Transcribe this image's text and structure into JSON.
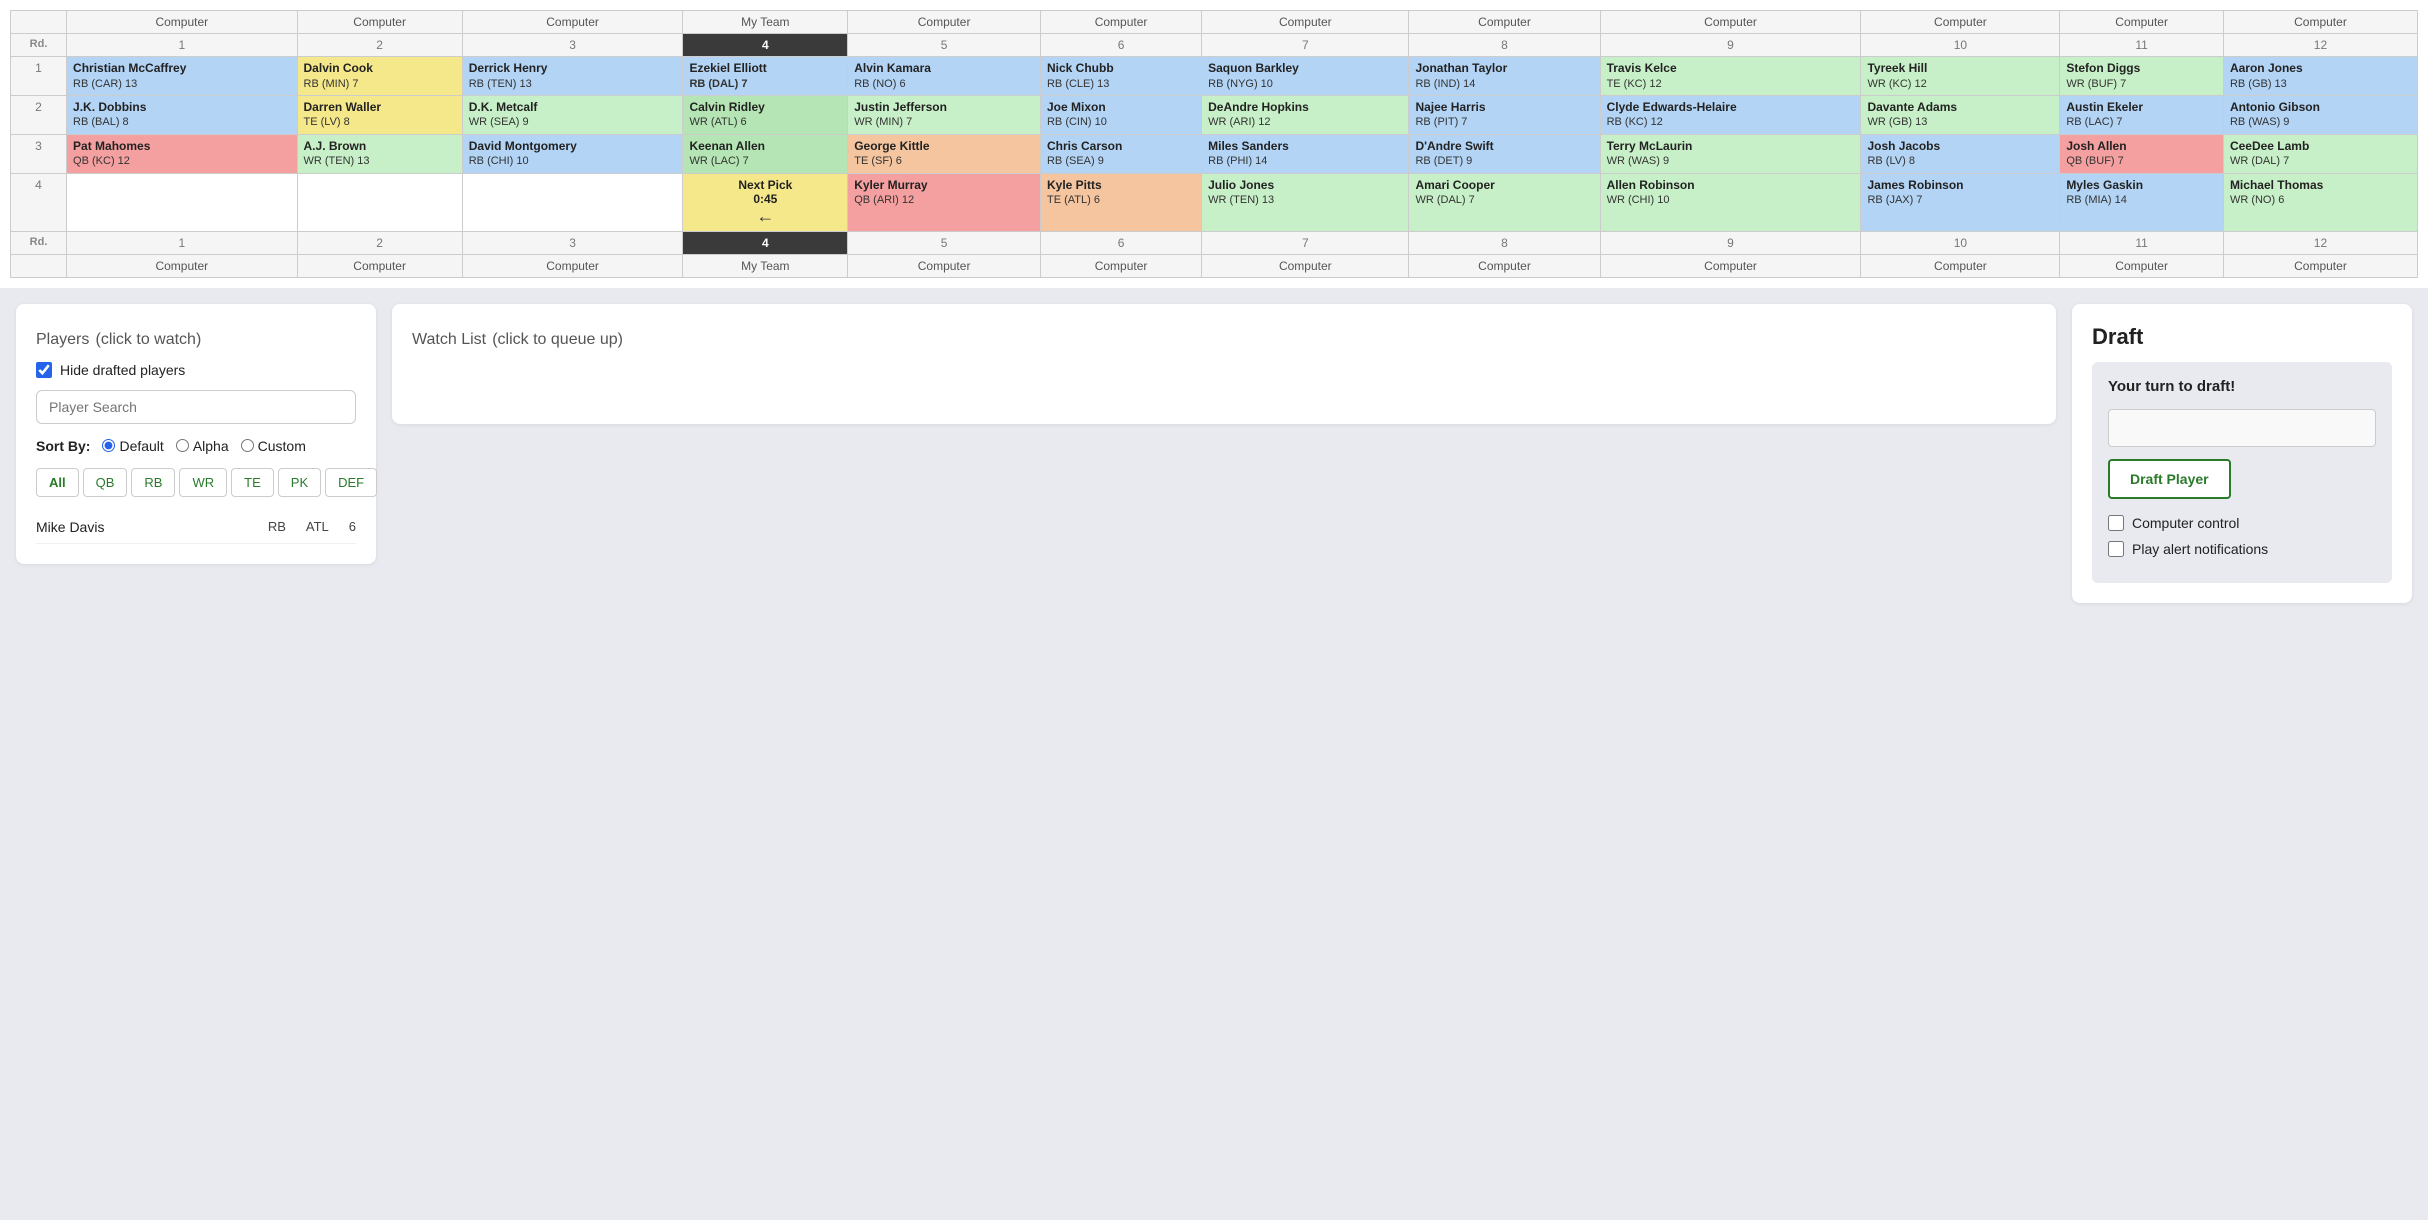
{
  "teams": [
    {
      "label": "Computer",
      "col": 1
    },
    {
      "label": "Computer",
      "col": 2
    },
    {
      "label": "Computer",
      "col": 3
    },
    {
      "label": "My Team",
      "col": 4
    },
    {
      "label": "Computer",
      "col": 5
    },
    {
      "label": "Computer",
      "col": 6
    },
    {
      "label": "Computer",
      "col": 7
    },
    {
      "label": "Computer",
      "col": 8
    },
    {
      "label": "Computer",
      "col": 9
    },
    {
      "label": "Computer",
      "col": 10
    },
    {
      "label": "Computer",
      "col": 11
    },
    {
      "label": "Computer",
      "col": 12
    }
  ],
  "rounds": [
    {
      "round": 1,
      "picks": [
        {
          "name": "Christian McCaffrey",
          "pos": "RB (CAR) 13",
          "color": "cell-blue"
        },
        {
          "name": "Dalvin Cook",
          "pos": "RB (MIN) 7",
          "color": "cell-yellow"
        },
        {
          "name": "Derrick Henry",
          "pos": "RB (TEN) 13",
          "color": "cell-blue"
        },
        {
          "name": "Ezekiel Elliott",
          "pos": "RB (DAL) 7",
          "color": "cell-blue",
          "myteam": true
        },
        {
          "name": "Alvin Kamara",
          "pos": "RB (NO) 6",
          "color": "cell-blue"
        },
        {
          "name": "Nick Chubb",
          "pos": "RB (CLE) 13",
          "color": "cell-blue"
        },
        {
          "name": "Saquon Barkley",
          "pos": "RB (NYG) 10",
          "color": "cell-blue"
        },
        {
          "name": "Jonathan Taylor",
          "pos": "RB (IND) 14",
          "color": "cell-blue"
        },
        {
          "name": "Travis Kelce",
          "pos": "TE (KC) 12",
          "color": "cell-green"
        },
        {
          "name": "Tyreek Hill",
          "pos": "WR (KC) 12",
          "color": "cell-green"
        },
        {
          "name": "Stefon Diggs",
          "pos": "WR (BUF) 7",
          "color": "cell-green"
        },
        {
          "name": "Aaron Jones",
          "pos": "RB (GB) 13",
          "color": "cell-blue"
        }
      ]
    },
    {
      "round": 2,
      "picks": [
        {
          "name": "J.K. Dobbins",
          "pos": "RB (BAL) 8",
          "color": "cell-blue"
        },
        {
          "name": "Darren Waller",
          "pos": "TE (LV) 8",
          "color": "cell-yellow"
        },
        {
          "name": "D.K. Metcalf",
          "pos": "WR (SEA) 9",
          "color": "cell-green"
        },
        {
          "name": "Calvin Ridley",
          "pos": "WR (ATL) 6",
          "color": "cell-green",
          "myteam": true
        },
        {
          "name": "Justin Jefferson",
          "pos": "WR (MIN) 7",
          "color": "cell-green"
        },
        {
          "name": "Joe Mixon",
          "pos": "RB (CIN) 10",
          "color": "cell-blue"
        },
        {
          "name": "DeAndre Hopkins",
          "pos": "WR (ARI) 12",
          "color": "cell-green"
        },
        {
          "name": "Najee Harris",
          "pos": "RB (PIT) 7",
          "color": "cell-blue"
        },
        {
          "name": "Clyde Edwards-Helaire",
          "pos": "RB (KC) 12",
          "color": "cell-blue"
        },
        {
          "name": "Davante Adams",
          "pos": "WR (GB) 13",
          "color": "cell-green"
        },
        {
          "name": "Austin Ekeler",
          "pos": "RB (LAC) 7",
          "color": "cell-blue"
        },
        {
          "name": "Antonio Gibson",
          "pos": "RB (WAS) 9",
          "color": "cell-blue"
        }
      ]
    },
    {
      "round": 3,
      "picks": [
        {
          "name": "Pat Mahomes",
          "pos": "QB (KC) 12",
          "color": "cell-red"
        },
        {
          "name": "A.J. Brown",
          "pos": "WR (TEN) 13",
          "color": "cell-green"
        },
        {
          "name": "David Montgomery",
          "pos": "RB (CHI) 10",
          "color": "cell-blue"
        },
        {
          "name": "Keenan Allen",
          "pos": "WR (LAC) 7",
          "color": "cell-green",
          "myteam": true
        },
        {
          "name": "George Kittle",
          "pos": "TE (SF) 6",
          "color": "cell-orange"
        },
        {
          "name": "Chris Carson",
          "pos": "RB (SEA) 9",
          "color": "cell-blue"
        },
        {
          "name": "Miles Sanders",
          "pos": "RB (PHI) 14",
          "color": "cell-blue"
        },
        {
          "name": "D'Andre Swift",
          "pos": "RB (DET) 9",
          "color": "cell-blue"
        },
        {
          "name": "Terry McLaurin",
          "pos": "WR (WAS) 9",
          "color": "cell-green"
        },
        {
          "name": "Josh Jacobs",
          "pos": "RB (LV) 8",
          "color": "cell-blue"
        },
        {
          "name": "Josh Allen",
          "pos": "QB (BUF) 7",
          "color": "cell-red"
        },
        {
          "name": "CeeDee Lamb",
          "pos": "WR (DAL) 7",
          "color": "cell-green"
        }
      ]
    },
    {
      "round": 4,
      "picks": [
        {
          "name": "",
          "pos": "",
          "color": ""
        },
        {
          "name": "",
          "pos": "",
          "color": ""
        },
        {
          "name": "",
          "pos": "",
          "color": ""
        },
        {
          "name": "NEXT_PICK",
          "pos": "",
          "color": "",
          "myteam": true
        },
        {
          "name": "Kyler Murray",
          "pos": "QB (ARI) 12",
          "color": "cell-red"
        },
        {
          "name": "Kyle Pitts",
          "pos": "TE (ATL) 6",
          "color": "cell-orange"
        },
        {
          "name": "Julio Jones",
          "pos": "WR (TEN) 13",
          "color": "cell-green"
        },
        {
          "name": "Amari Cooper",
          "pos": "WR (DAL) 7",
          "color": "cell-green"
        },
        {
          "name": "Allen Robinson",
          "pos": "WR (CHI) 10",
          "color": "cell-green"
        },
        {
          "name": "James Robinson",
          "pos": "RB (JAX) 7",
          "color": "cell-blue"
        },
        {
          "name": "Myles Gaskin",
          "pos": "RB (MIA) 14",
          "color": "cell-blue"
        },
        {
          "name": "Michael Thomas",
          "pos": "WR (NO) 6",
          "color": "cell-green"
        }
      ]
    }
  ],
  "next_pick": {
    "label": "Next Pick",
    "time": "0:45",
    "arrow": "←"
  },
  "players_panel": {
    "title": "Players",
    "subtitle": "(click to watch)",
    "hide_drafted_label": "Hide drafted players",
    "search_placeholder": "Player Search",
    "sort_label": "Sort By:",
    "sort_options": [
      "Default",
      "Alpha",
      "Custom"
    ],
    "filter_tabs": [
      "All",
      "QB",
      "RB",
      "WR",
      "TE",
      "PK",
      "DEF"
    ],
    "active_filter": "All",
    "active_sort": "Default",
    "player_row": {
      "name": "Mike Davis",
      "pos": "RB",
      "team": "ATL",
      "round": "6"
    }
  },
  "watchlist_panel": {
    "title": "Watch List",
    "subtitle": "(click to queue up)"
  },
  "draft_panel": {
    "title": "Draft",
    "your_turn": "Your turn to draft!",
    "input_placeholder": "",
    "draft_btn_label": "Draft Player",
    "computer_control_label": "Computer control",
    "play_alerts_label": "Play alert notifications"
  }
}
